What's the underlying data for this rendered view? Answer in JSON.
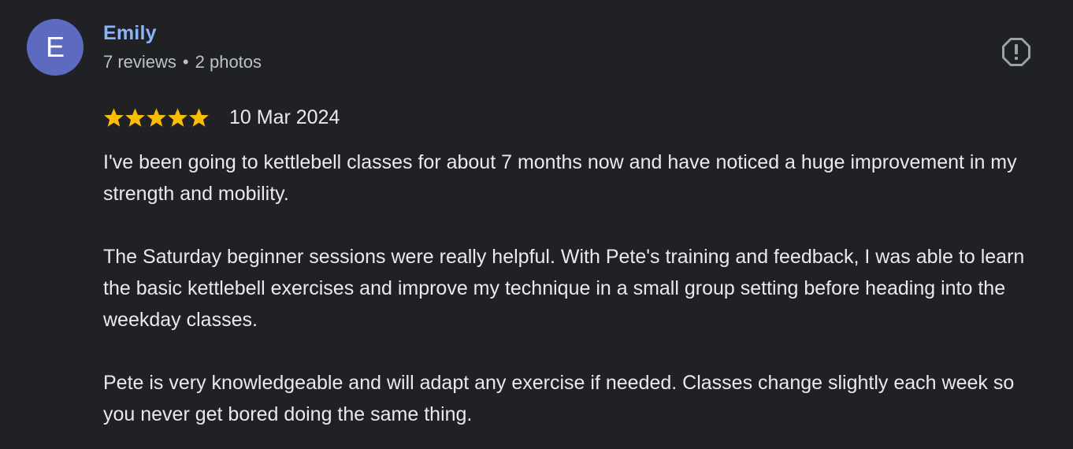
{
  "reviewer": {
    "initial": "E",
    "name": "Emily",
    "reviews_count": "7 reviews",
    "separator": "•",
    "photos_count": "2 photos",
    "avatar_color": "#5c6bc0",
    "name_color": "#8ab4f8"
  },
  "rating": {
    "stars": 5,
    "max_stars": 5,
    "star_color": "#fbbc04",
    "date": "10 Mar 2024"
  },
  "review": {
    "paragraphs": [
      "I've been going to kettlebell classes for about 7 months now and have noticed a huge improvement in my strength and mobility.",
      "The Saturday beginner sessions were really helpful. With Pete's training and feedback, I was able to learn the basic kettlebell exercises and improve my technique in a small group setting before heading into the weekday classes.",
      "Pete is very knowledgeable and will adapt any exercise if needed. Classes change slightly each week so you never get bored doing the same thing."
    ]
  },
  "actions": {
    "flag_icon": "report-icon"
  }
}
